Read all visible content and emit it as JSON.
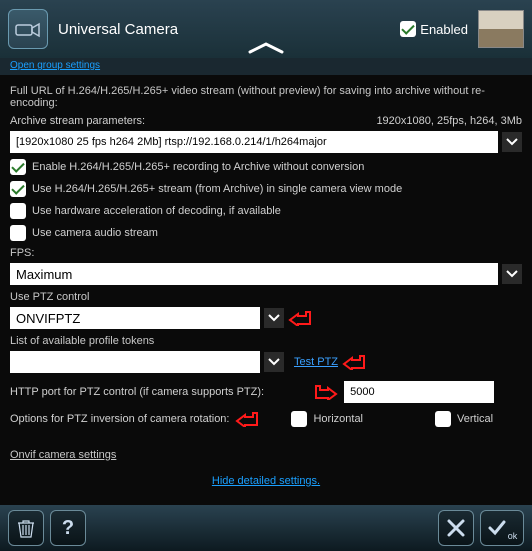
{
  "header": {
    "title": "Universal Camera",
    "enabled_label": "Enabled",
    "enabled_checked": true
  },
  "group_settings_link": "Open group settings",
  "desc_line": "Full URL of H.264/H.265/H.265+ video stream (without preview) for saving into archive without re-encoding:",
  "archive_params_label": "Archive stream parameters:",
  "archive_params_value": "1920x1080, 25fps, h264, 3Mb",
  "archive_url": "[1920x1080 25 fps h264 2Mb] rtsp://192.168.0.214/1/h264major",
  "checks": {
    "enable_recording": {
      "label": "Enable H.264/H.265/H.265+ recording to Archive without conversion",
      "checked": true
    },
    "use_archive_single": {
      "label": "Use H.264/H.265/H.265+ stream (from Archive) in single camera view mode",
      "checked": true
    },
    "hw_accel": {
      "label": "Use hardware acceleration of decoding, if available",
      "checked": false
    },
    "audio": {
      "label": "Use camera audio stream",
      "checked": false
    }
  },
  "fps_label": "FPS:",
  "fps_value": "Maximum",
  "ptz": {
    "use_label": "Use PTZ control",
    "selected": "ONVIFPTZ",
    "tokens_label": "List of available profile tokens",
    "tokens_value": "",
    "test_link": "Test PTZ",
    "http_port_label": "HTTP port for PTZ control (if camera supports PTZ):",
    "http_port_value": "5000",
    "inversion_label": "Options for PTZ inversion of camera rotation:",
    "horizontal_label": "Horizontal",
    "vertical_label": "Vertical"
  },
  "onvif_settings_link": "Onvif camera settings",
  "hide_settings_link": "Hide detailed settings.",
  "footer": {
    "ok_suffix": "ok"
  }
}
